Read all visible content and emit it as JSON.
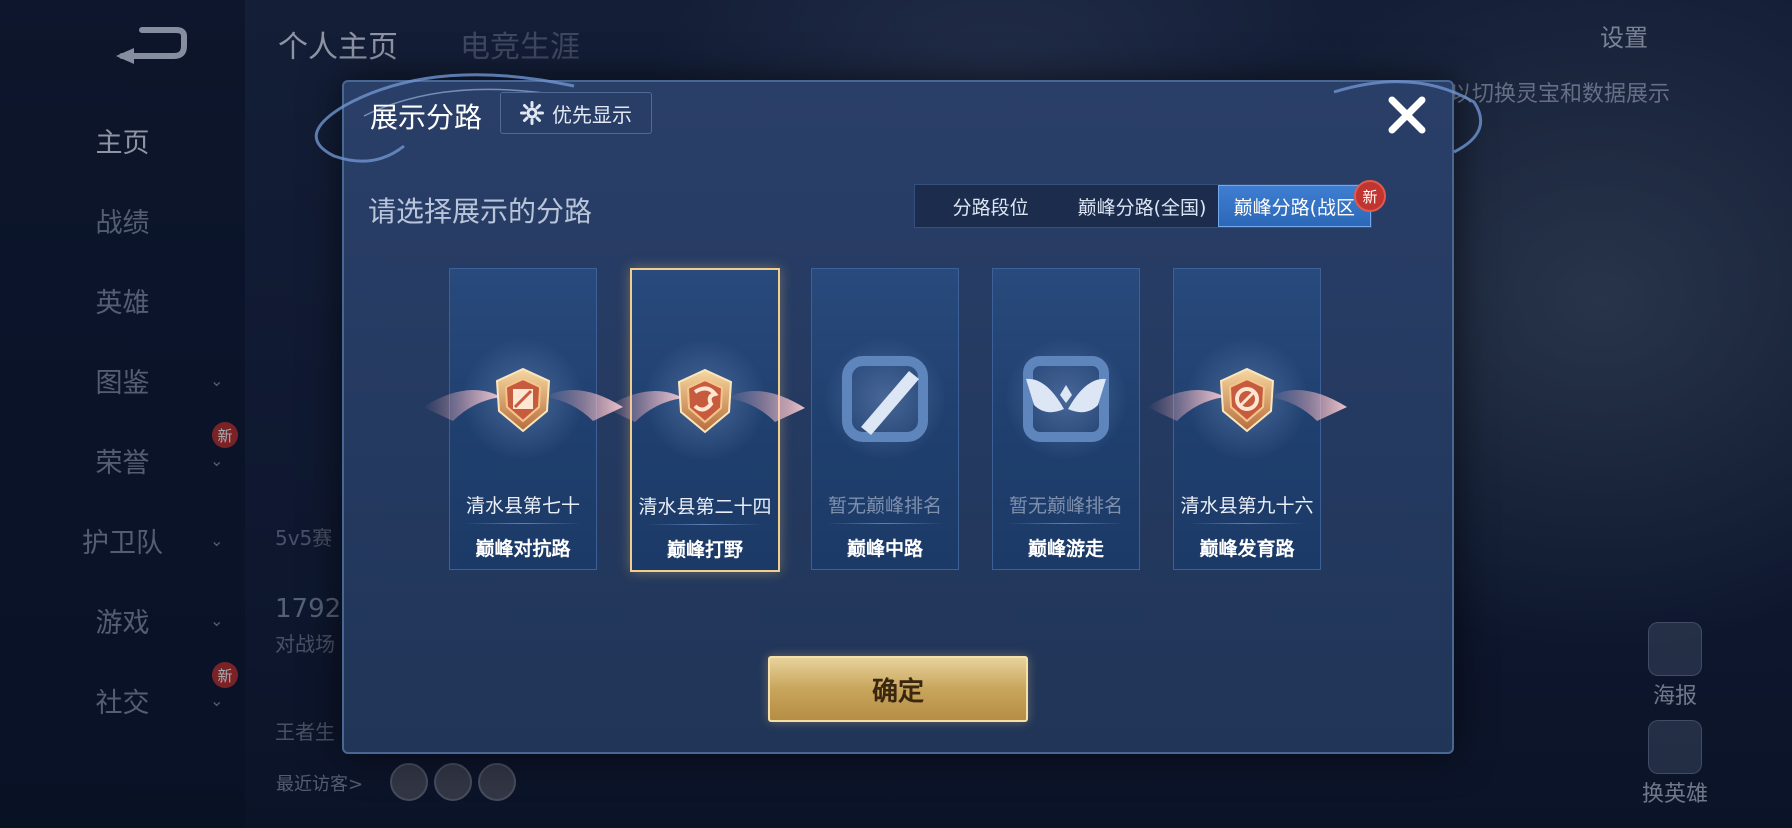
{
  "background": {
    "top_tabs": [
      "个人主页",
      "电竞生涯"
    ],
    "settings_label": "设置",
    "hint_text": "以切换灵宝和数据展示",
    "sidebar_items": [
      {
        "label": "主页",
        "active": true,
        "has_chevron": false,
        "badge": ""
      },
      {
        "label": "战绩",
        "active": false,
        "has_chevron": false,
        "badge": ""
      },
      {
        "label": "英雄",
        "active": false,
        "has_chevron": false,
        "badge": ""
      },
      {
        "label": "图鉴",
        "active": false,
        "has_chevron": true,
        "badge": ""
      },
      {
        "label": "荣誉",
        "active": false,
        "has_chevron": true,
        "badge": "新"
      },
      {
        "label": "护卫队",
        "active": false,
        "has_chevron": true,
        "badge": ""
      },
      {
        "label": "游戏",
        "active": false,
        "has_chevron": true,
        "badge": ""
      },
      {
        "label": "社交",
        "active": false,
        "has_chevron": true,
        "badge": "新"
      }
    ],
    "left_partial": {
      "mode": "5v5赛",
      "number": "1792",
      "arena": "对战场",
      "king": "王者生"
    },
    "recent_visitors_label": "最近访客>",
    "right_buttons": [
      "海报",
      "换英雄"
    ]
  },
  "modal": {
    "title": "展示分路",
    "priority_label": "优先显示",
    "subtitle": "请选择展示的分路",
    "tabs": [
      {
        "label": "分路段位",
        "selected": false
      },
      {
        "label": "巅峰分路(全国)",
        "selected": false
      },
      {
        "label": "巅峰分路(战区",
        "selected": true
      }
    ],
    "tab_new_badge": "新",
    "cards": [
      {
        "rank": "清水县第七十",
        "lane": "巅峰对抗路",
        "has_rank": true,
        "selected": false,
        "emblem": "clash-lane-medal-icon"
      },
      {
        "rank": "清水县第二十四",
        "lane": "巅峰打野",
        "has_rank": true,
        "selected": true,
        "emblem": "jungle-medal-icon"
      },
      {
        "rank": "暂无巅峰排名",
        "lane": "巅峰中路",
        "has_rank": false,
        "selected": false,
        "emblem": "mid-lane-icon"
      },
      {
        "rank": "暂无巅峰排名",
        "lane": "巅峰游走",
        "has_rank": false,
        "selected": false,
        "emblem": "roam-icon"
      },
      {
        "rank": "清水县第九十六",
        "lane": "巅峰发育路",
        "has_rank": true,
        "selected": false,
        "emblem": "farm-lane-medal-icon"
      }
    ],
    "confirm_label": "确定"
  },
  "colors": {
    "accent_gold": "#f1cf8a",
    "tab_selected": "#3e7ed0",
    "badge_red": "#c0352f"
  }
}
